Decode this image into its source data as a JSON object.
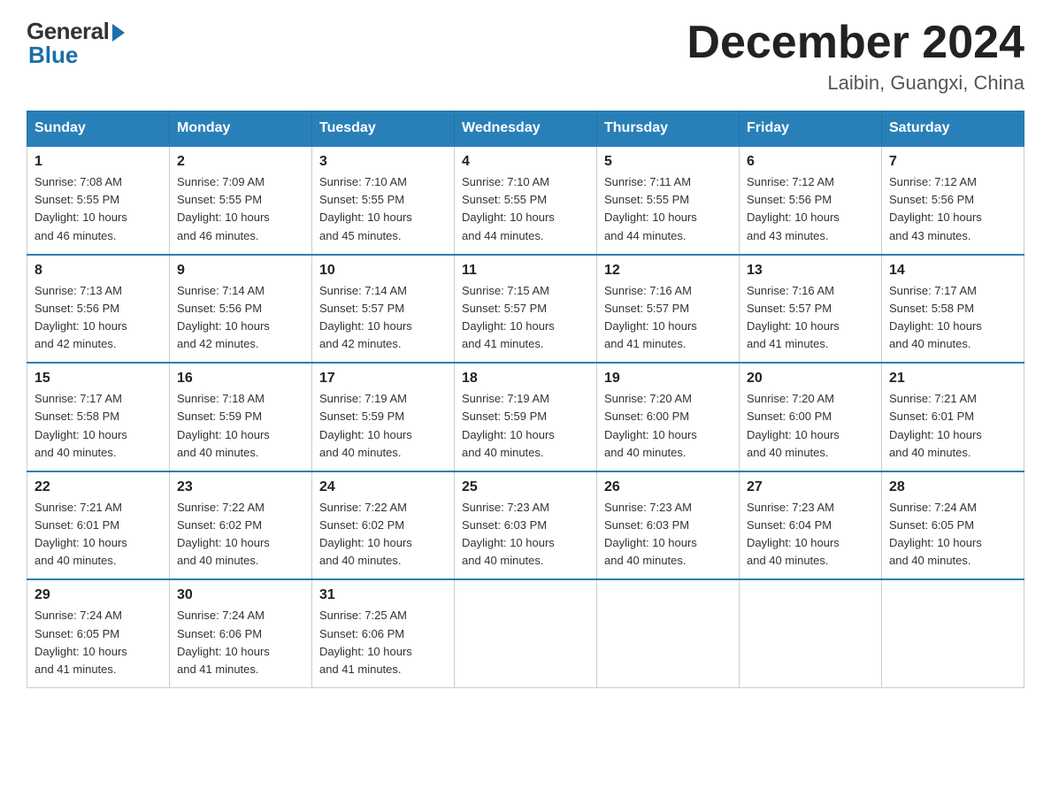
{
  "header": {
    "logo_general": "General",
    "logo_blue": "Blue",
    "month_title": "December 2024",
    "location": "Laibin, Guangxi, China"
  },
  "weekdays": [
    "Sunday",
    "Monday",
    "Tuesday",
    "Wednesday",
    "Thursday",
    "Friday",
    "Saturday"
  ],
  "weeks": [
    [
      {
        "day": "1",
        "sunrise": "7:08 AM",
        "sunset": "5:55 PM",
        "daylight": "10 hours and 46 minutes."
      },
      {
        "day": "2",
        "sunrise": "7:09 AM",
        "sunset": "5:55 PM",
        "daylight": "10 hours and 46 minutes."
      },
      {
        "day": "3",
        "sunrise": "7:10 AM",
        "sunset": "5:55 PM",
        "daylight": "10 hours and 45 minutes."
      },
      {
        "day": "4",
        "sunrise": "7:10 AM",
        "sunset": "5:55 PM",
        "daylight": "10 hours and 44 minutes."
      },
      {
        "day": "5",
        "sunrise": "7:11 AM",
        "sunset": "5:55 PM",
        "daylight": "10 hours and 44 minutes."
      },
      {
        "day": "6",
        "sunrise": "7:12 AM",
        "sunset": "5:56 PM",
        "daylight": "10 hours and 43 minutes."
      },
      {
        "day": "7",
        "sunrise": "7:12 AM",
        "sunset": "5:56 PM",
        "daylight": "10 hours and 43 minutes."
      }
    ],
    [
      {
        "day": "8",
        "sunrise": "7:13 AM",
        "sunset": "5:56 PM",
        "daylight": "10 hours and 42 minutes."
      },
      {
        "day": "9",
        "sunrise": "7:14 AM",
        "sunset": "5:56 PM",
        "daylight": "10 hours and 42 minutes."
      },
      {
        "day": "10",
        "sunrise": "7:14 AM",
        "sunset": "5:57 PM",
        "daylight": "10 hours and 42 minutes."
      },
      {
        "day": "11",
        "sunrise": "7:15 AM",
        "sunset": "5:57 PM",
        "daylight": "10 hours and 41 minutes."
      },
      {
        "day": "12",
        "sunrise": "7:16 AM",
        "sunset": "5:57 PM",
        "daylight": "10 hours and 41 minutes."
      },
      {
        "day": "13",
        "sunrise": "7:16 AM",
        "sunset": "5:57 PM",
        "daylight": "10 hours and 41 minutes."
      },
      {
        "day": "14",
        "sunrise": "7:17 AM",
        "sunset": "5:58 PM",
        "daylight": "10 hours and 40 minutes."
      }
    ],
    [
      {
        "day": "15",
        "sunrise": "7:17 AM",
        "sunset": "5:58 PM",
        "daylight": "10 hours and 40 minutes."
      },
      {
        "day": "16",
        "sunrise": "7:18 AM",
        "sunset": "5:59 PM",
        "daylight": "10 hours and 40 minutes."
      },
      {
        "day": "17",
        "sunrise": "7:19 AM",
        "sunset": "5:59 PM",
        "daylight": "10 hours and 40 minutes."
      },
      {
        "day": "18",
        "sunrise": "7:19 AM",
        "sunset": "5:59 PM",
        "daylight": "10 hours and 40 minutes."
      },
      {
        "day": "19",
        "sunrise": "7:20 AM",
        "sunset": "6:00 PM",
        "daylight": "10 hours and 40 minutes."
      },
      {
        "day": "20",
        "sunrise": "7:20 AM",
        "sunset": "6:00 PM",
        "daylight": "10 hours and 40 minutes."
      },
      {
        "day": "21",
        "sunrise": "7:21 AM",
        "sunset": "6:01 PM",
        "daylight": "10 hours and 40 minutes."
      }
    ],
    [
      {
        "day": "22",
        "sunrise": "7:21 AM",
        "sunset": "6:01 PM",
        "daylight": "10 hours and 40 minutes."
      },
      {
        "day": "23",
        "sunrise": "7:22 AM",
        "sunset": "6:02 PM",
        "daylight": "10 hours and 40 minutes."
      },
      {
        "day": "24",
        "sunrise": "7:22 AM",
        "sunset": "6:02 PM",
        "daylight": "10 hours and 40 minutes."
      },
      {
        "day": "25",
        "sunrise": "7:23 AM",
        "sunset": "6:03 PM",
        "daylight": "10 hours and 40 minutes."
      },
      {
        "day": "26",
        "sunrise": "7:23 AM",
        "sunset": "6:03 PM",
        "daylight": "10 hours and 40 minutes."
      },
      {
        "day": "27",
        "sunrise": "7:23 AM",
        "sunset": "6:04 PM",
        "daylight": "10 hours and 40 minutes."
      },
      {
        "day": "28",
        "sunrise": "7:24 AM",
        "sunset": "6:05 PM",
        "daylight": "10 hours and 40 minutes."
      }
    ],
    [
      {
        "day": "29",
        "sunrise": "7:24 AM",
        "sunset": "6:05 PM",
        "daylight": "10 hours and 41 minutes."
      },
      {
        "day": "30",
        "sunrise": "7:24 AM",
        "sunset": "6:06 PM",
        "daylight": "10 hours and 41 minutes."
      },
      {
        "day": "31",
        "sunrise": "7:25 AM",
        "sunset": "6:06 PM",
        "daylight": "10 hours and 41 minutes."
      },
      null,
      null,
      null,
      null
    ]
  ],
  "labels": {
    "sunrise": "Sunrise: ",
    "sunset": "Sunset: ",
    "daylight": "Daylight: "
  }
}
